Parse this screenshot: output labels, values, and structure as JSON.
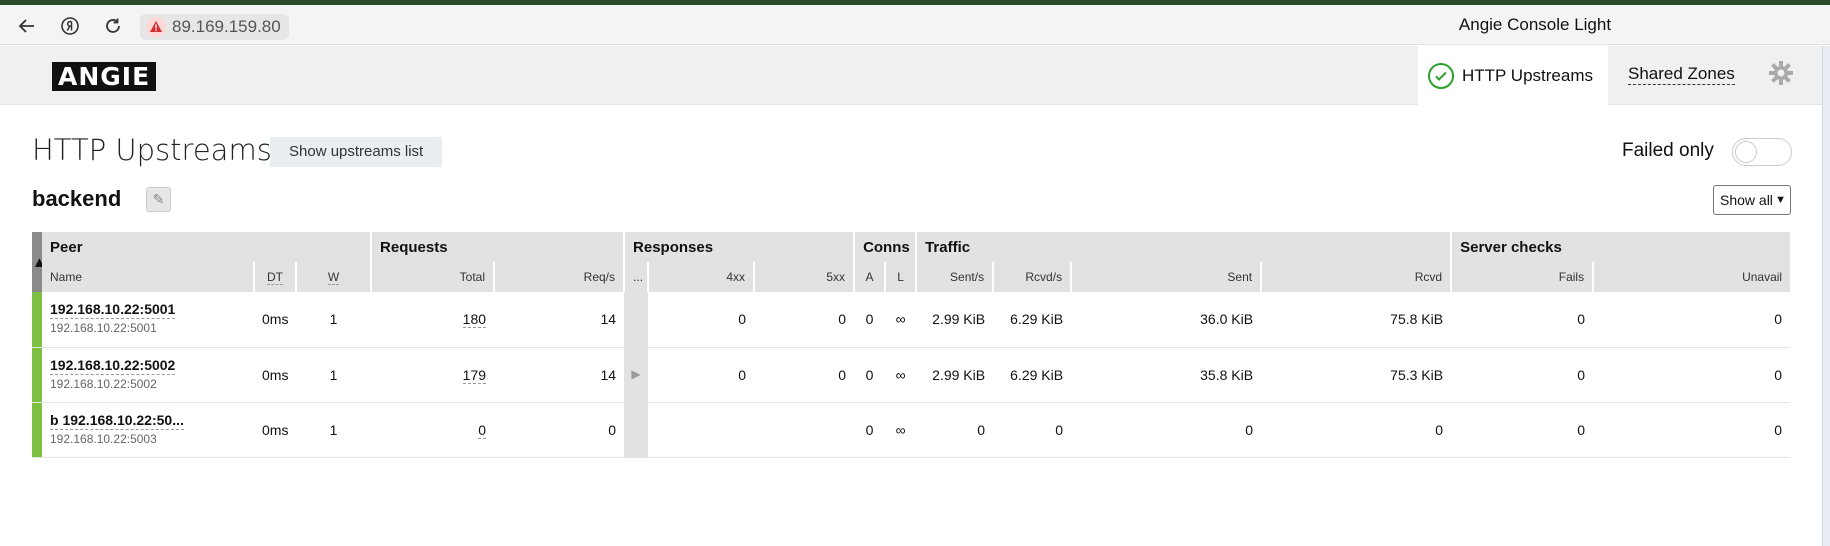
{
  "browser": {
    "url": "89.169.159.80",
    "window_title": "Angie Console Light"
  },
  "header": {
    "logo": "ANGIE",
    "tab_http_upstreams": "HTTP Upstreams",
    "tab_shared_zones": "Shared Zones"
  },
  "page": {
    "title": "HTTP Upstreams",
    "show_list_button": "Show upstreams list",
    "failed_only_label": "Failed only",
    "failed_only_enabled": false
  },
  "upstream": {
    "name": "backend",
    "filter_selected": "Show all",
    "groups": {
      "peer": "Peer",
      "requests": "Requests",
      "responses": "Responses",
      "conns": "Conns",
      "traffic": "Traffic",
      "server_checks": "Server checks"
    },
    "columns": {
      "name": "Name",
      "dt": "DT",
      "w": "W",
      "total": "Total",
      "reqs": "Req/s",
      "resp_more": "...",
      "r4xx": "4xx",
      "r5xx": "5xx",
      "a": "A",
      "l": "L",
      "sent_s": "Sent/s",
      "rcvd_s": "Rcvd/s",
      "sent": "Sent",
      "rcvd": "Rcvd",
      "fails": "Fails",
      "unavail": "Unavail"
    },
    "rows": [
      {
        "name": "192.168.10.22:5001",
        "address": "192.168.10.22:5001",
        "dt": "0ms",
        "w": "1",
        "total": "180",
        "reqs": "14",
        "r4xx": "0",
        "r5xx": "0",
        "a": "0",
        "l": "∞",
        "sent_s": "2.99 KiB",
        "rcvd_s": "6.29 KiB",
        "sent": "36.0 KiB",
        "rcvd": "75.8 KiB",
        "fails": "0",
        "unavail": "0"
      },
      {
        "name": "192.168.10.22:5002",
        "address": "192.168.10.22:5002",
        "dt": "0ms",
        "w": "1",
        "total": "179",
        "reqs": "14",
        "r4xx": "0",
        "r5xx": "0",
        "a": "0",
        "l": "∞",
        "sent_s": "2.99 KiB",
        "rcvd_s": "6.29 KiB",
        "sent": "35.8 KiB",
        "rcvd": "75.3 KiB",
        "fails": "0",
        "unavail": "0"
      },
      {
        "name": "b 192.168.10.22:50...",
        "address": "192.168.10.22:5003",
        "dt": "0ms",
        "w": "1",
        "total": "0",
        "reqs": "0",
        "r4xx": "",
        "r5xx": "",
        "a": "0",
        "l": "∞",
        "sent_s": "0",
        "rcvd_s": "0",
        "sent": "0",
        "rcvd": "0",
        "fails": "0",
        "unavail": "0"
      }
    ]
  }
}
